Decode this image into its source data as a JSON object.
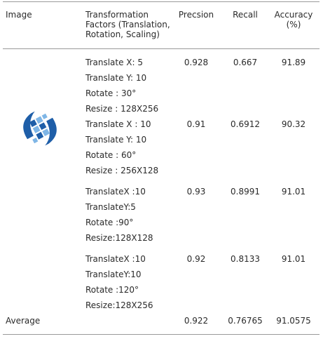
{
  "header": {
    "image": "Image",
    "factors": "Transformation Factors (Translation, Rotation, Scaling)",
    "precision": "Precsion",
    "recall": "Recall",
    "accuracy": "Accuracy (%)"
  },
  "rows": [
    {
      "factors": [
        "Translate X: 5",
        "Translate Y: 10",
        "Rotate : 30°",
        "Resize : 128X256"
      ],
      "precision": "0.928",
      "recall": "0.667",
      "accuracy": "91.89"
    },
    {
      "factors": [
        "Translate X : 10",
        "Translate Y: 10",
        "Rotate : 60°",
        "Resize : 256X128"
      ],
      "precision": "0.91",
      "recall": "0.6912",
      "accuracy": "90.32"
    },
    {
      "factors": [
        "TranslateX :10",
        "TranslateY:5",
        "Rotate :90°",
        "Resize:128X128"
      ],
      "precision": "0.93",
      "recall": "0.8991",
      "accuracy": "91.01"
    },
    {
      "factors": [
        "TranslateX :10",
        "TranslateY:10",
        "Rotate :120°",
        "Resize:128X256"
      ],
      "precision": "0.92",
      "recall": "0.8133",
      "accuracy": "91.01"
    }
  ],
  "average": {
    "label": "Average",
    "precision": "0.922",
    "recall": "0.76765",
    "accuracy": "91.0575"
  },
  "colors": {
    "logo_blue": "#1e5ea8",
    "logo_light": "#7fb6e6",
    "rule": "#9a9a9a"
  }
}
